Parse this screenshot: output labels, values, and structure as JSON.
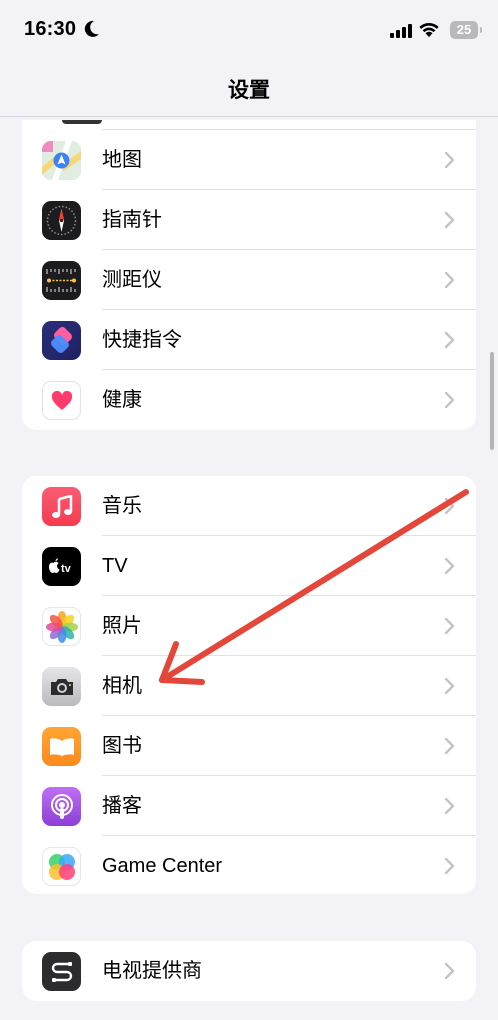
{
  "status_bar": {
    "time": "16:30",
    "battery_level": "25",
    "icons": [
      "moon-icon",
      "cellular-signal-icon",
      "wifi-icon",
      "battery-icon"
    ]
  },
  "nav": {
    "title": "设置"
  },
  "groups": [
    {
      "items": [
        {
          "label": "地图",
          "icon": "maps-icon"
        },
        {
          "label": "指南针",
          "icon": "compass-icon"
        },
        {
          "label": "测距仪",
          "icon": "measure-icon"
        },
        {
          "label": "快捷指令",
          "icon": "shortcuts-icon"
        },
        {
          "label": "健康",
          "icon": "health-icon"
        }
      ]
    },
    {
      "items": [
        {
          "label": "音乐",
          "icon": "music-icon"
        },
        {
          "label": "TV",
          "icon": "tv-icon"
        },
        {
          "label": "照片",
          "icon": "photos-icon"
        },
        {
          "label": "相机",
          "icon": "camera-icon"
        },
        {
          "label": "图书",
          "icon": "books-icon"
        },
        {
          "label": "播客",
          "icon": "podcasts-icon"
        },
        {
          "label": "Game Center",
          "icon": "game-center-icon"
        }
      ]
    },
    {
      "items": [
        {
          "label": "电视提供商",
          "icon": "tv-provider-icon"
        }
      ]
    }
  ],
  "annotation": {
    "type": "arrow",
    "color": "#e5463a",
    "points_to": "相机"
  }
}
